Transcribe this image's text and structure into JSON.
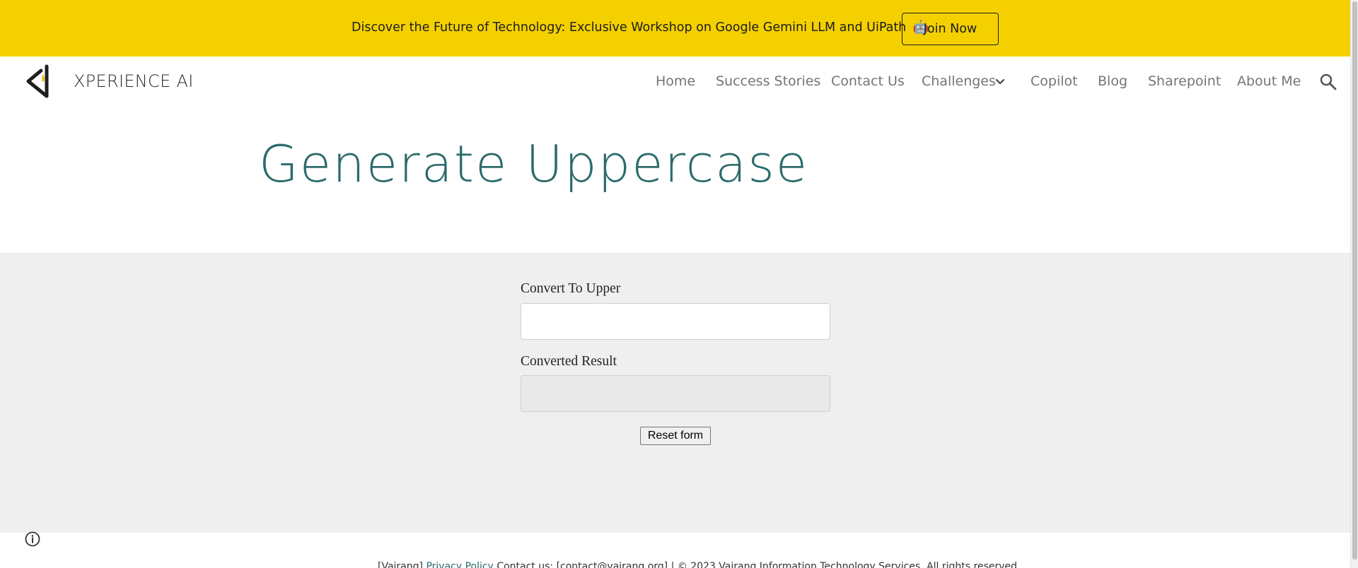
{
  "banner": {
    "text": "Discover the Future of Technology: Exclusive Workshop on Google Gemini LLM and UiPath",
    "emoji": "🤖",
    "join_label": "Join Now",
    "color": "#f4d000"
  },
  "header": {
    "site_title": "XPERIENCE AI",
    "nav": [
      {
        "label": "Home"
      },
      {
        "label": "Success Stories"
      },
      {
        "label": "Contact Us"
      },
      {
        "label": "Challenges",
        "has_dropdown": true
      },
      {
        "label": "Copilot"
      },
      {
        "label": "Blog"
      },
      {
        "label": "Sharepoint"
      },
      {
        "label": "About Me"
      }
    ],
    "search_icon": "search-icon"
  },
  "main": {
    "title": "Generate Uppercase",
    "title_color": "#2c6b6b"
  },
  "form": {
    "input_label": "Convert To Upper",
    "input_value": "",
    "result_label": "Converted Result",
    "result_value": "",
    "reset_label": "Reset form"
  },
  "footer": {
    "prefix": "[Vairang]",
    "privacy_link": "Privacy Policy",
    "rest": "Contact us: [contact@vairang.org] | © 2023 Vairang Information Technology Services. All rights reserved."
  }
}
